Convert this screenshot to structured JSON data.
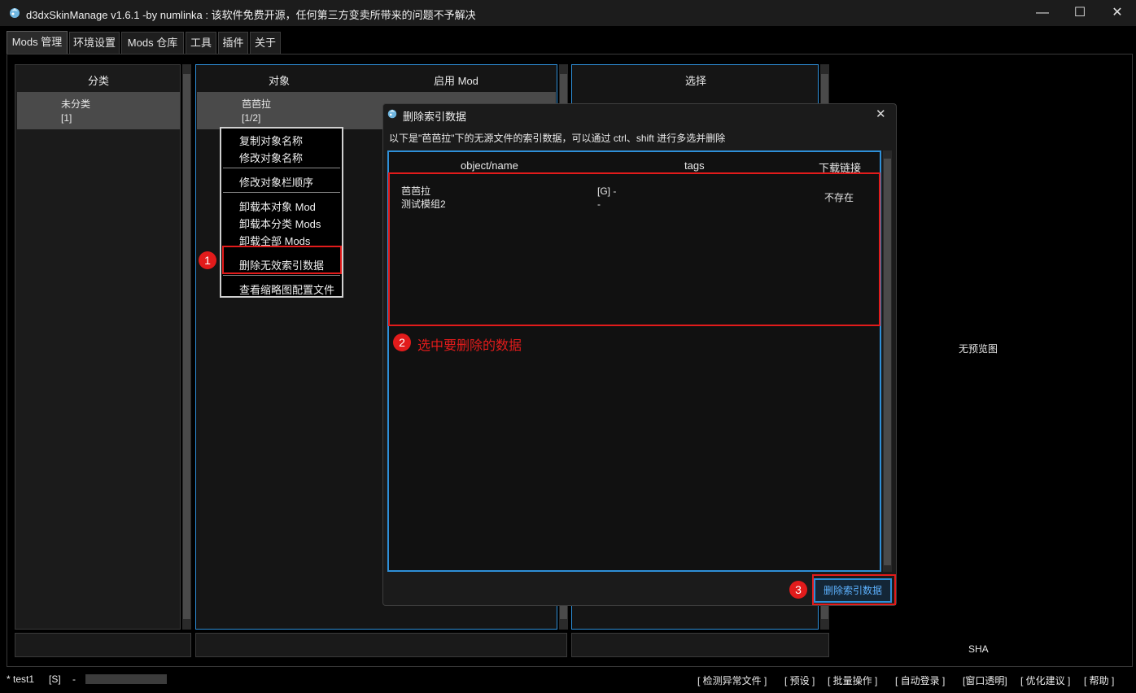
{
  "window": {
    "title": "d3dxSkinManage v1.6.1 -by numlinka : 该软件免费开源，任何第三方变卖所带来的问题不予解决",
    "minimize": "—",
    "maximize": "☐",
    "close": "✕"
  },
  "tabs": [
    "Mods 管理",
    "环境设置",
    "Mods 仓库",
    "工具",
    "插件",
    "关于"
  ],
  "category_panel": {
    "header": "分类",
    "items": [
      {
        "name": "未分类",
        "count": "[1]"
      }
    ]
  },
  "object_panel": {
    "header_object": "对象",
    "header_enabled": "启用 Mod",
    "items": [
      {
        "name": "芭芭拉",
        "count": "[1/2]"
      }
    ]
  },
  "select_panel": {
    "header": "选择"
  },
  "preview": {
    "no_preview": "无预览图",
    "sha": "SHA"
  },
  "context_menu": {
    "copy_name": "复制对象名称",
    "rename": "修改对象名称",
    "reorder": "修改对象栏顺序",
    "unload_object": "卸载本对象 Mod",
    "unload_category": "卸载本分类 Mods",
    "unload_all": "卸载全部 Mods",
    "delete_invalid": "删除无效索引数据",
    "view_thumb_config": "查看缩略图配置文件"
  },
  "dialog": {
    "title": "删除索引数据",
    "close": "✕",
    "description": "以下是\"芭芭拉\"下的无源文件的索引数据，可以通过 ctrl、shift 进行多选并删除",
    "columns": {
      "name": "object/name",
      "tags": "tags",
      "link": "下载链接"
    },
    "rows": [
      {
        "object": "芭芭拉",
        "name": "测试模组2",
        "tags_line1": "[G] -",
        "tags_line2": "-",
        "link": "不存在"
      }
    ],
    "delete_button": "删除索引数据"
  },
  "annotations": {
    "step1": "1",
    "step2": "2",
    "step2_text": "选中要删除的数据",
    "step3": "3",
    "color": "#e21b1b"
  },
  "status_bar": {
    "user": "* test1",
    "flag": "[S]",
    "dash": "-",
    "links": [
      "[ 检测异常文件 ]",
      "[ 预设 ]",
      "[ 批量操作 ]",
      "[ 自动登录 ]",
      "[窗口透明]",
      "[ 优化建议 ]",
      "[ 帮助 ]"
    ]
  },
  "colors": {
    "accent": "#2e8fd8",
    "background": "#000000",
    "panel": "#1b1b1b"
  }
}
